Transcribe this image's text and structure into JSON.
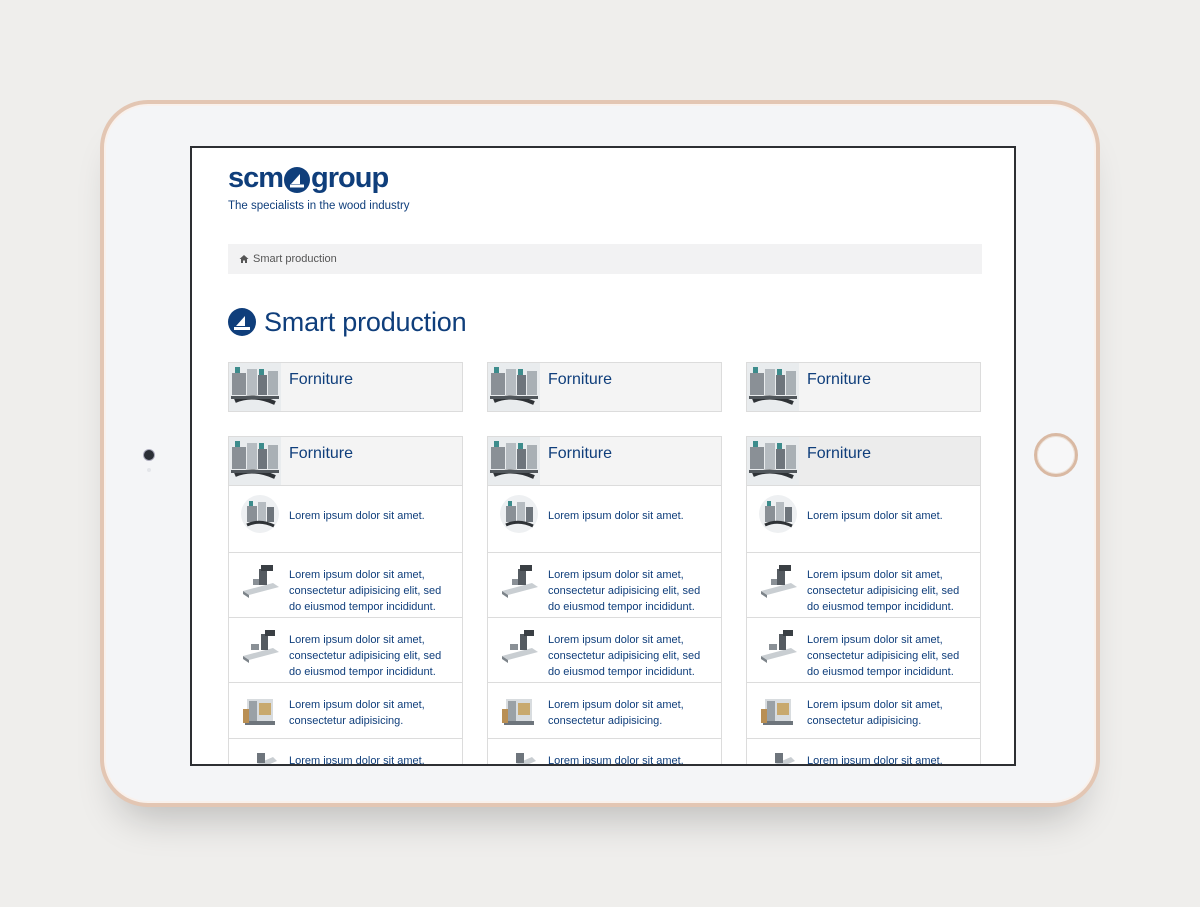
{
  "device": {
    "type": "tablet",
    "frame_color": "#e3c6b3"
  },
  "header": {
    "logo_left": "scm",
    "logo_right": "group",
    "tagline": "The specialists in the wood industry"
  },
  "breadcrumb": {
    "label": "Smart production"
  },
  "page": {
    "title": "Smart production"
  },
  "colors": {
    "brand": "#0f3e7b",
    "panel": "#f4f4f4",
    "border": "#dcdcdc"
  },
  "top_cards": [
    {
      "title": "Forniture"
    },
    {
      "title": "Forniture"
    },
    {
      "title": "Forniture"
    }
  ],
  "expanded_cards": [
    {
      "title": "Forniture",
      "items": [
        "Lorem ipsum dolor sit amet.",
        "Lorem ipsum dolor sit amet, consectetur adipisicing elit, sed do eiusmod tempor incididunt.",
        "Lorem ipsum dolor sit amet, consectetur adipisicing elit, sed do eiusmod tempor incididunt.",
        "Lorem ipsum dolor sit amet, consectetur adipisicing.",
        "Lorem ipsum dolor sit amet,"
      ]
    },
    {
      "title": "Forniture",
      "items": [
        "Lorem ipsum dolor sit amet.",
        "Lorem ipsum dolor sit amet, consectetur adipisicing elit, sed do eiusmod tempor incididunt.",
        "Lorem ipsum dolor sit amet, consectetur adipisicing elit, sed do eiusmod tempor incididunt.",
        "Lorem ipsum dolor sit amet, consectetur adipisicing.",
        "Lorem ipsum dolor sit amet,"
      ]
    },
    {
      "title": "Forniture",
      "items": [
        "Lorem ipsum dolor sit amet.",
        "Lorem ipsum dolor sit amet, consectetur adipisicing elit, sed do eiusmod tempor incididunt.",
        "Lorem ipsum dolor sit amet, consectetur adipisicing elit, sed do eiusmod tempor incididunt.",
        "Lorem ipsum dolor sit amet, consectetur adipisicing.",
        "Lorem ipsum dolor sit amet,"
      ]
    }
  ]
}
